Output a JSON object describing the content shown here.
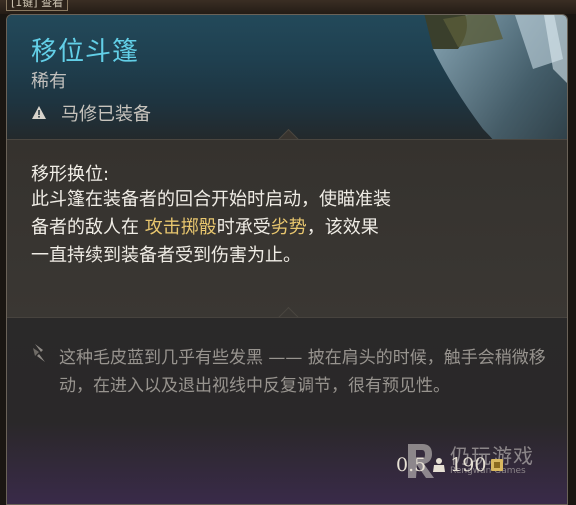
{
  "top_bar": {
    "key_hint": "[1键] 查看"
  },
  "item": {
    "name": "移位斗篷",
    "rarity": "稀有",
    "equipped_status": "马修已装备",
    "equipped_icon": "warning-icon",
    "name_color": "#62cfe7",
    "keyword_color": "#e8c66e"
  },
  "passive": {
    "name": "移形换位:",
    "desc_part1": "此斗篷在装备者的回合开始时启动，使瞄准装备者的敌人在 ",
    "keyword1": "攻击掷骰",
    "desc_part2": "时承受",
    "keyword2": "劣势",
    "desc_part3": "，该效果一直持续到装备者受到伤害为止。"
  },
  "lore": {
    "icon": "quill-icon",
    "text": "这种毛皮蓝到几乎有些发黑 —— 披在肩头的时候，触手会稍微移动，在进入以及退出视线中反复调节，很有预见性。"
  },
  "footer": {
    "weight": "0.5",
    "weight_icon": "weight-icon",
    "price": "190",
    "price_icon": "coin-icon"
  },
  "watermark": {
    "text": "仍玩游戏",
    "subtext": "Rengwan Games"
  }
}
